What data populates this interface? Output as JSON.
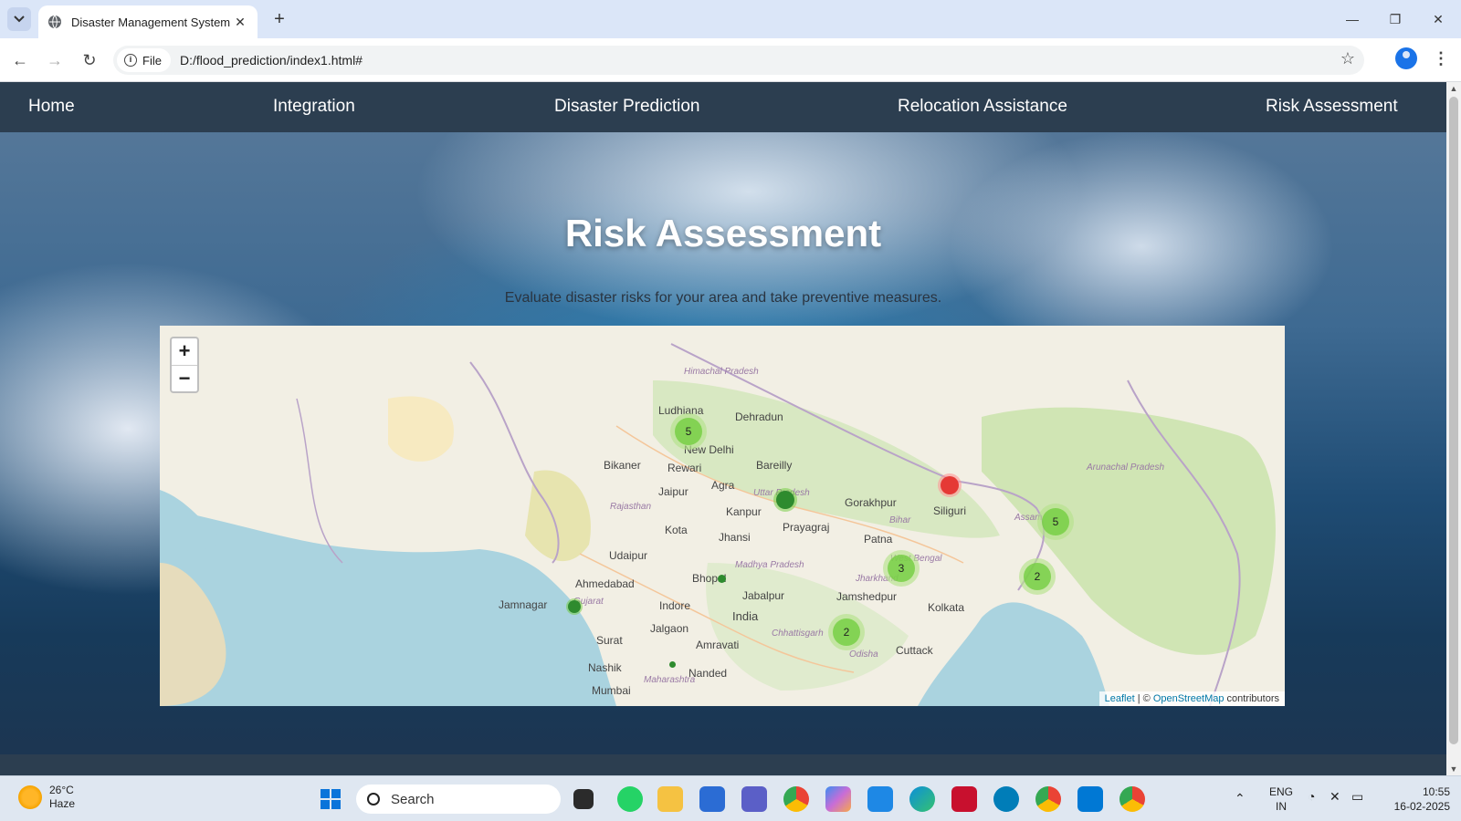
{
  "browser": {
    "tab_title": "Disaster Management System",
    "url": "D:/flood_prediction/index1.html#",
    "site_info_label": "File",
    "window_controls": [
      "minimize-icon",
      "restore-icon",
      "close-icon"
    ]
  },
  "nav": {
    "items": [
      {
        "label": "Home"
      },
      {
        "label": "Integration"
      },
      {
        "label": "Disaster Prediction"
      },
      {
        "label": "Relocation Assistance"
      },
      {
        "label": "Risk Assessment"
      }
    ]
  },
  "hero": {
    "title": "Risk Assessment",
    "subtitle": "Evaluate disaster risks for your area and take preventive measures."
  },
  "map": {
    "zoom_in": "+",
    "zoom_out": "−",
    "attribution_leaflet": "Leaflet",
    "attribution_sep": " | © ",
    "attribution_osm": "OpenStreetMap",
    "attribution_tail": " contributors",
    "clusters": [
      {
        "count": "5"
      },
      {
        "count": "3"
      },
      {
        "count": "2"
      },
      {
        "count": "2"
      },
      {
        "count": "5"
      }
    ],
    "labels": {
      "ludhiana": "Ludhiana",
      "dehradun": "Dehradun",
      "new_delhi": "New Delhi",
      "bareilly": "Bareilly",
      "bikaner": "Bikaner",
      "rewari": "Rewari",
      "jaipur": "Jaipur",
      "agra": "Agra",
      "kanpur": "Kanpur",
      "gorakhpur": "Gorakhpur",
      "siliguri": "Siliguri",
      "prayagraj": "Prayagraj",
      "patna": "Patna",
      "kota": "Kota",
      "jhansi": "Jhansi",
      "udaipur": "Udaipur",
      "ahmedabad": "Ahmedabad",
      "bhopal": "Bhopal",
      "jamnagar": "Jamnagar",
      "indore": "Indore",
      "jabalpur": "Jabalpur",
      "jamshedpur": "Jamshedpur",
      "kolkata": "Kolkata",
      "india": "India",
      "surat": "Surat",
      "jalgaon": "Jalgaon",
      "amravati": "Amravati",
      "cuttack": "Cuttack",
      "nashik": "Nashik",
      "nanded": "Nanded",
      "mumbai": "Mumbai",
      "himachal": "Himachal Pradesh",
      "uttar_pradesh": "Uttar Pradesh",
      "rajasthan": "Rajasthan",
      "madhya_pradesh": "Madhya Pradesh",
      "bihar": "Bihar",
      "jharkhand": "Jharkhand",
      "west_bengal": "West Bengal",
      "chhattisgarh": "Chhattisgarh",
      "odisha": "Odisha",
      "maharashtra": "Maharashtra",
      "gujarat": "Gujarat",
      "assam": "Assam",
      "arunachal": "Arunachal Pradesh"
    }
  },
  "taskbar": {
    "weather_temp": "26°C",
    "weather_desc": "Haze",
    "search_placeholder": "Search",
    "lang_top": "ENG",
    "lang_bottom": "IN",
    "time": "10:55",
    "date": "16-02-2025"
  },
  "colors": {
    "nav_bg": "#2c3e50",
    "cluster_outer": "#b5e28c",
    "cluster_inner": "#6ecc39",
    "marker_green": "#2e8b2e",
    "marker_red": "#e53935"
  }
}
